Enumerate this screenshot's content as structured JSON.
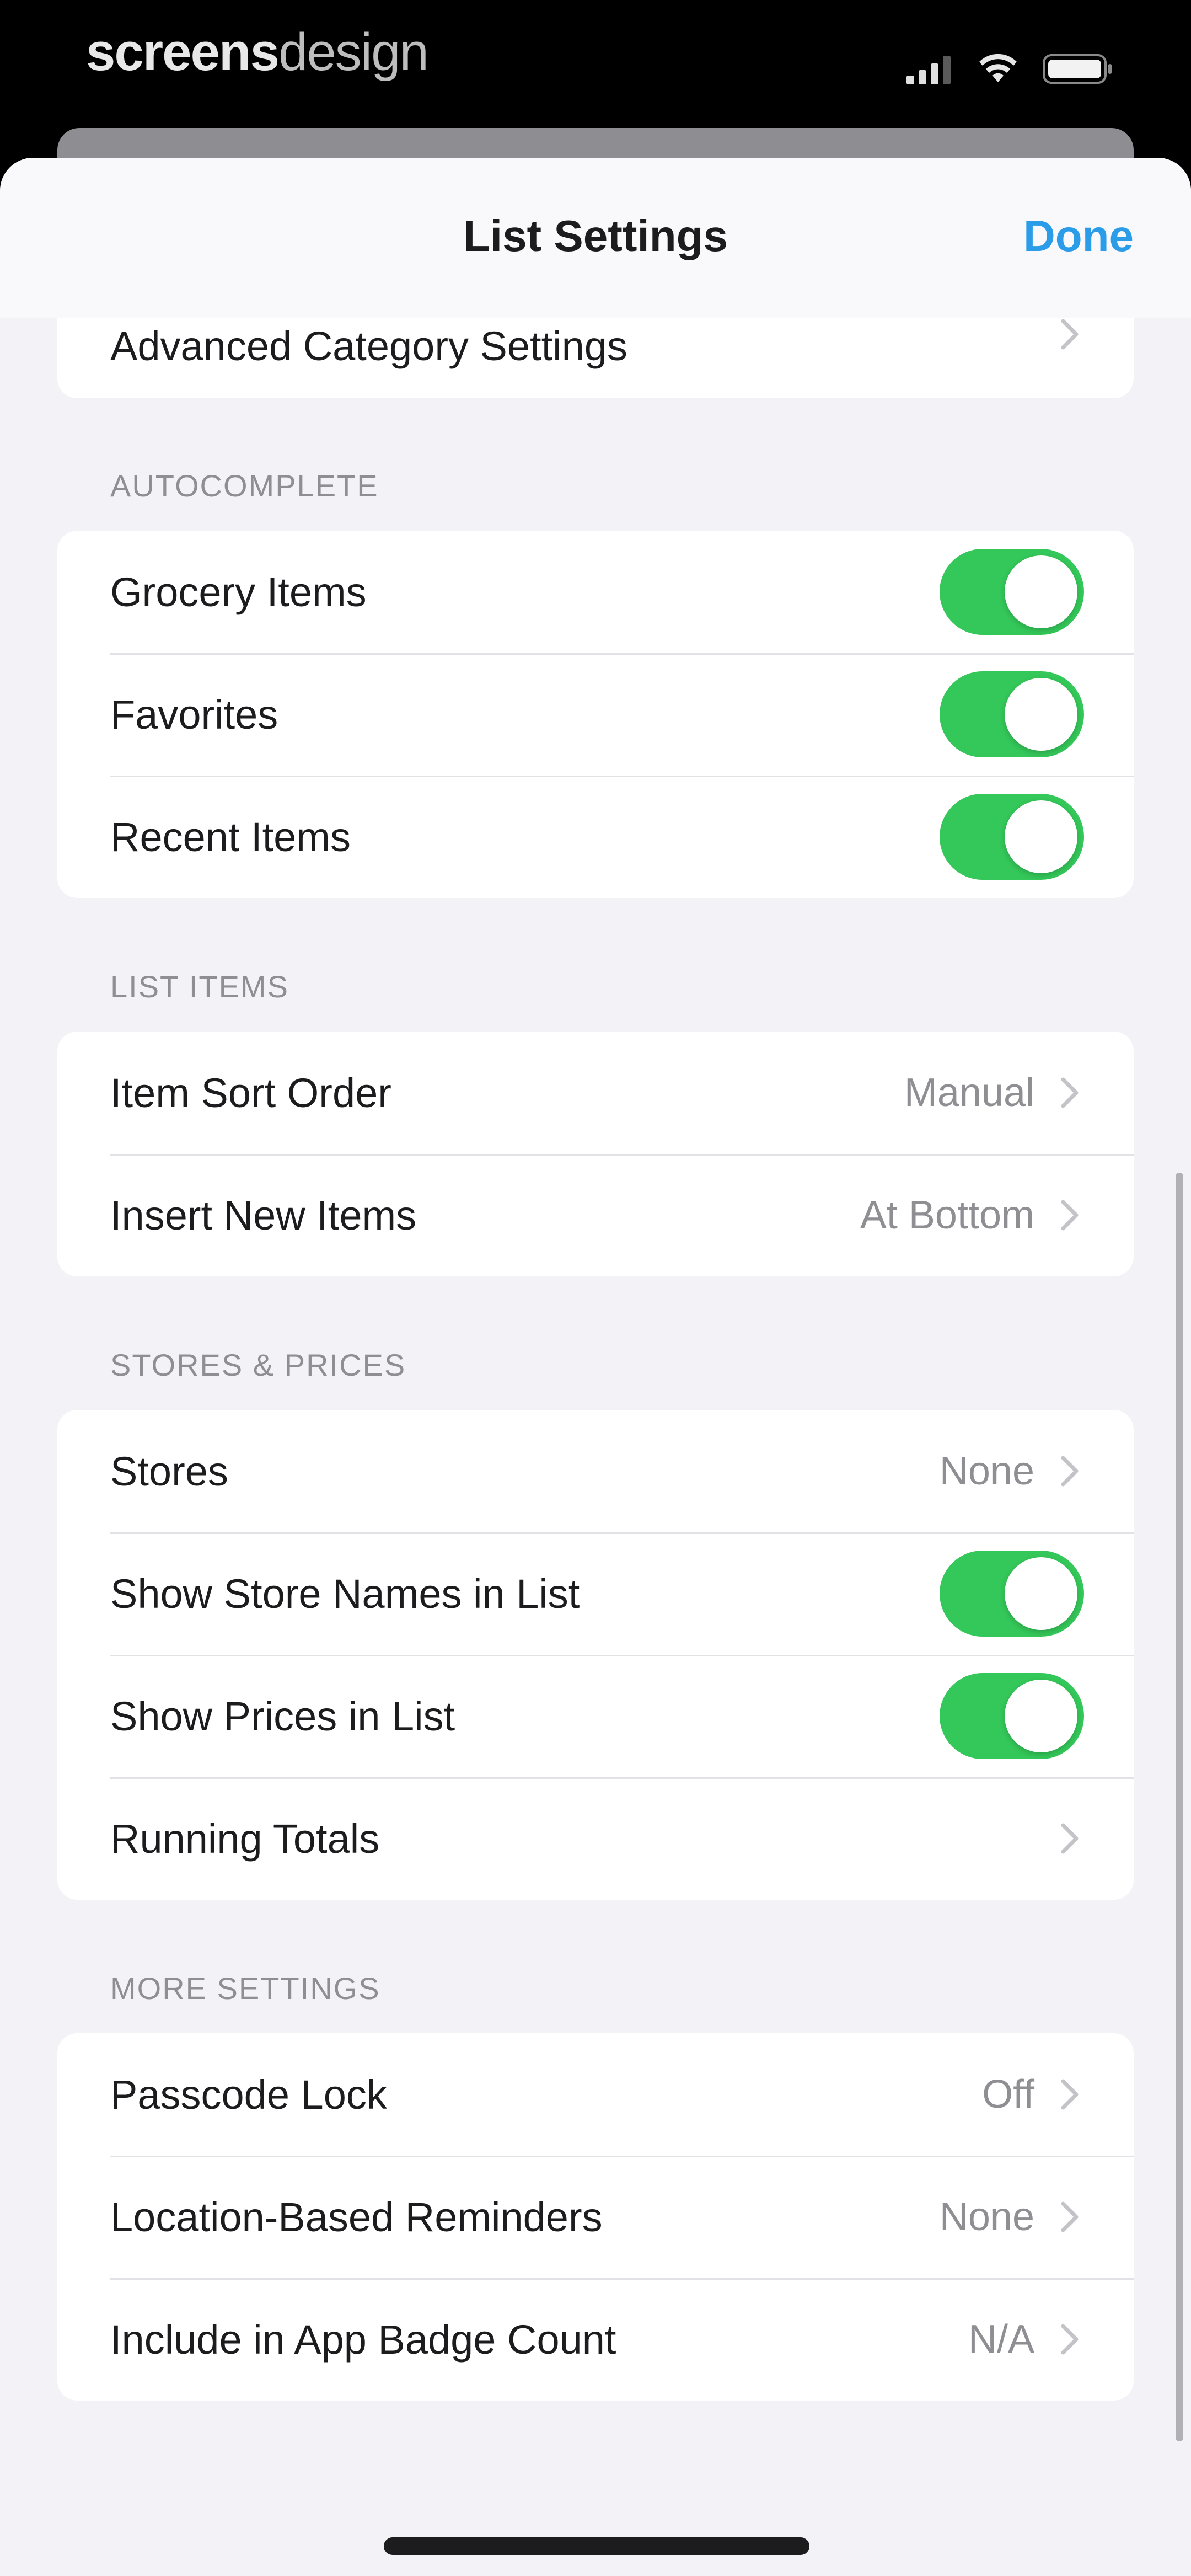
{
  "status_bar": {
    "watermark_bold": "screens",
    "watermark_light": "design"
  },
  "nav": {
    "title": "List Settings",
    "done_label": "Done"
  },
  "partial_row": {
    "label": "Advanced Category Settings"
  },
  "sections": {
    "autocomplete": {
      "header": "AUTOCOMPLETE",
      "grocery_items": {
        "label": "Grocery Items",
        "on": true
      },
      "favorites": {
        "label": "Favorites",
        "on": true
      },
      "recent_items": {
        "label": "Recent Items",
        "on": true
      }
    },
    "list_items": {
      "header": "LIST ITEMS",
      "item_sort_order": {
        "label": "Item Sort Order",
        "value": "Manual"
      },
      "insert_new_items": {
        "label": "Insert New Items",
        "value": "At Bottom"
      }
    },
    "stores_prices": {
      "header": "STORES & PRICES",
      "stores": {
        "label": "Stores",
        "value": "None"
      },
      "show_store_names": {
        "label": "Show Store Names in List",
        "on": true
      },
      "show_prices": {
        "label": "Show Prices in List",
        "on": true
      },
      "running_totals": {
        "label": "Running Totals"
      }
    },
    "more_settings": {
      "header": "MORE SETTINGS",
      "passcode_lock": {
        "label": "Passcode Lock",
        "value": "Off"
      },
      "location_reminders": {
        "label": "Location-Based Reminders",
        "value": "None"
      },
      "app_badge_count": {
        "label": "Include in App Badge Count",
        "value": "N/A"
      }
    }
  },
  "colors": {
    "accent": "#2a9ce8",
    "toggle_on": "#34c759",
    "sheet_background": "#f2f2f7"
  }
}
